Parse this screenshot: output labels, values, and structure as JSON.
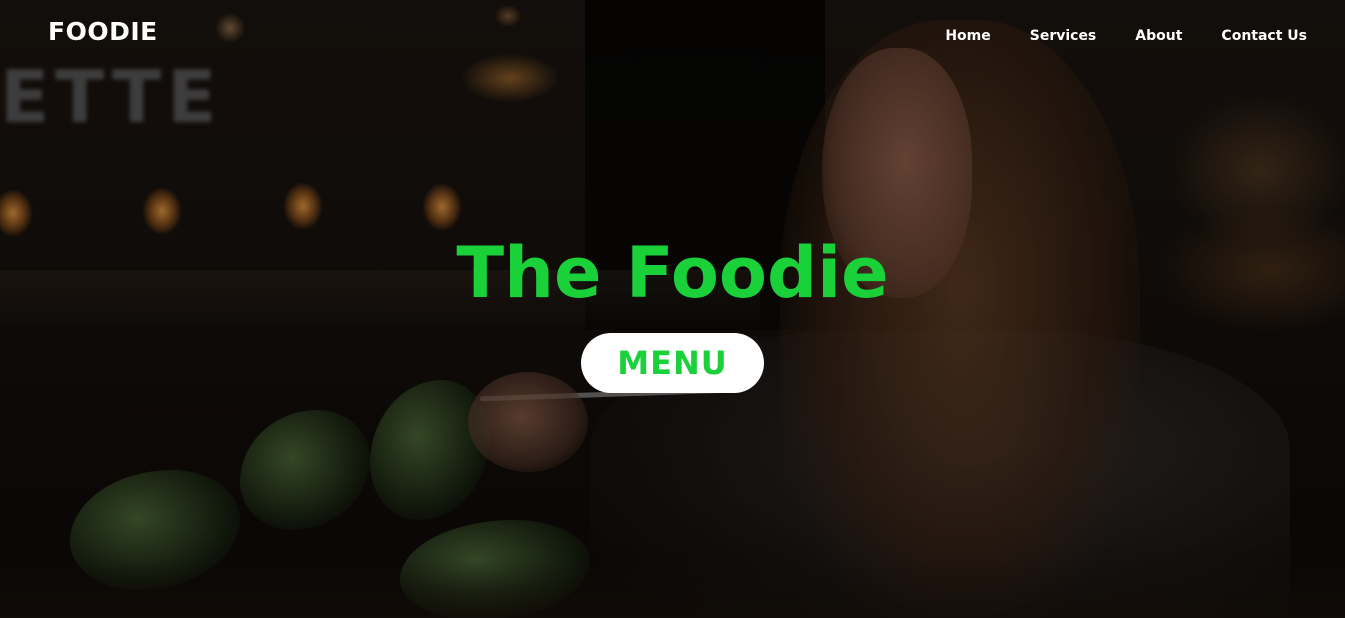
{
  "brand": {
    "logo_text": "FOODIE"
  },
  "nav": {
    "items": [
      {
        "label": "Home"
      },
      {
        "label": "Services"
      },
      {
        "label": "About"
      },
      {
        "label": "Contact Us"
      }
    ]
  },
  "hero": {
    "title": "The Foodie",
    "menu_button_label": "MENU",
    "background_sign_text": "ETTE"
  },
  "colors": {
    "accent": "#1ad13a",
    "button_bg": "#ffffff",
    "nav_text": "#ffffff"
  }
}
